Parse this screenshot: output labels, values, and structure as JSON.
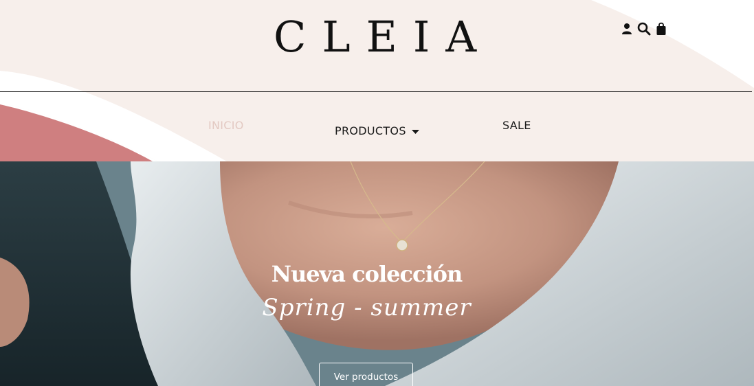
{
  "brand": {
    "logo_text": "CLEIA"
  },
  "header": {
    "icons": [
      "user-icon",
      "search-icon",
      "shopping-bag-icon"
    ]
  },
  "nav": {
    "items": [
      {
        "label": "INICIO",
        "active": true
      },
      {
        "label": "PRODUCTOS",
        "has_dropdown": true
      },
      {
        "label": "SALE"
      }
    ]
  },
  "hero": {
    "title": "Nueva colección",
    "subtitle": "Spring - summer",
    "button_label": "Ver productos"
  },
  "colors": {
    "header_bg": "#f7efeb",
    "accent_pink": "#cf7f80",
    "active_nav": "#e3c9c2",
    "text_dark": "#111111"
  }
}
